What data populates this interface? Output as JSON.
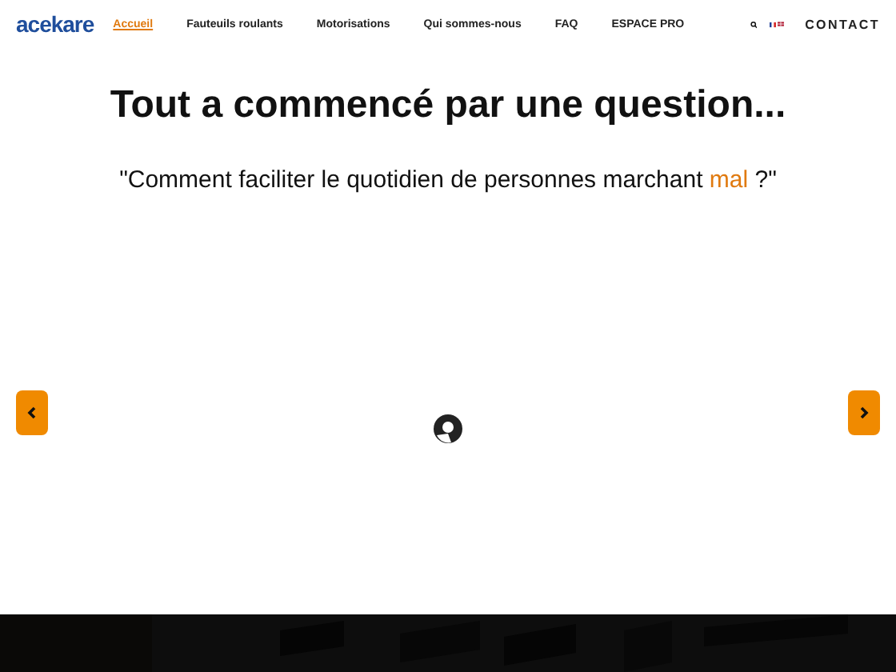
{
  "header": {
    "logo": "acekare",
    "nav": [
      {
        "label": "Accueil",
        "selected": true
      },
      {
        "label": "Fauteuils roulants",
        "selected": false
      },
      {
        "label": "Motorisations",
        "selected": false
      },
      {
        "label": "Qui sommes-nous",
        "selected": false
      },
      {
        "label": "FAQ",
        "selected": false
      },
      {
        "label": "ESPACE PRO",
        "selected": false
      }
    ],
    "contact": "CONTACT"
  },
  "heading": "Tout a commencé par une question...",
  "quote": [
    {
      "text": "\"Comment faciliter le quotidien de personnes marchant ",
      "highlight": false
    },
    {
      "text": "mal",
      "highlight": true
    },
    {
      "text": " ?\"",
      "highlight": false
    }
  ]
}
